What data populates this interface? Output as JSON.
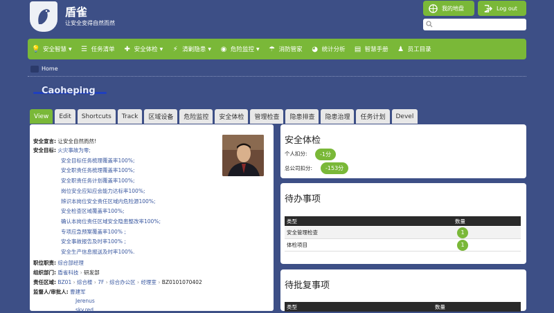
{
  "site": {
    "title": "盾雀",
    "slogan": "让安全变得自然而然"
  },
  "header": {
    "map_btn": "我的地盘",
    "logout_btn": "Log out",
    "search_placeholder": ""
  },
  "nav": [
    {
      "label": "安全智慧",
      "icon": "bulb-icon",
      "caret": true
    },
    {
      "label": "任务清单",
      "icon": "list-icon",
      "caret": false
    },
    {
      "label": "安全体检",
      "icon": "plus-icon",
      "caret": true
    },
    {
      "label": "清剿隐患",
      "icon": "bolt-icon",
      "caret": true
    },
    {
      "label": "危险监控",
      "icon": "monitor-icon",
      "caret": true
    },
    {
      "label": "消防管家",
      "icon": "umbrella-icon",
      "caret": false
    },
    {
      "label": "统计分析",
      "icon": "pie-icon",
      "caret": false
    },
    {
      "label": "智慧手册",
      "icon": "book-icon",
      "caret": false
    },
    {
      "label": "员工目录",
      "icon": "person-icon",
      "caret": false
    }
  ],
  "breadcrumb": {
    "home": "Home"
  },
  "page_title": "Caoheping",
  "tabs": [
    "View",
    "Edit",
    "Shortcuts",
    "Track",
    "区域设备",
    "危险监控",
    "安全体检",
    "管理检查",
    "隐患排查",
    "隐患治理",
    "任务计划",
    "Devel"
  ],
  "profile": {
    "declaration_label": "安全宣言:",
    "declaration": "让安全自然而然!",
    "goals_label": "安全目标:",
    "goals": [
      "火灾事故为零;",
      "安全目标任务梳理覆盖率100%;",
      "安全职责任务梳理覆盖率100%;",
      "安全职责任务计划覆盖率100%;",
      "岗位安全应知应会能力达标率100%;",
      "辨识本岗位安全责任区域内危险源100%;",
      "安全检查区域覆盖率100%;",
      "确认本岗位责任区域安全隐患整改率100%;",
      "专项应急预案覆盖率100% ;",
      "安全事故报告及时率100% ;",
      "安全生产信息报送及时率100%."
    ],
    "duty_label": "职位职责:",
    "duty": "综合部经理",
    "dept_label": "组织部门:",
    "dept": [
      "盾雀科技",
      "研发部"
    ],
    "area_label": "责任区域:",
    "area": [
      "BZ01",
      "综合楼",
      "7F",
      "综合办公区",
      "经理室",
      "BZ0101070402"
    ],
    "supervisor_label": "监督人/审批人:",
    "supervisors": [
      "曹建军",
      "Jerenus",
      "sky.red"
    ]
  },
  "checkup": {
    "title": "安全体检",
    "personal_label": "个人扣分:",
    "personal": "-1分",
    "company_label": "总公司扣分:",
    "company": "-153分"
  },
  "todo": {
    "title": "待办事项",
    "col_type": "类型",
    "col_count": "数量",
    "rows": [
      {
        "type": "安全管理检查",
        "count": "1"
      },
      {
        "type": "体检项目",
        "count": "1"
      }
    ]
  },
  "approve": {
    "title": "待批复事项",
    "col_type": "类型",
    "col_count": "数量"
  },
  "colors": {
    "brand_green": "#7ab838",
    "page_bg": "#3d4f86",
    "link_blue": "#3a58a0"
  }
}
